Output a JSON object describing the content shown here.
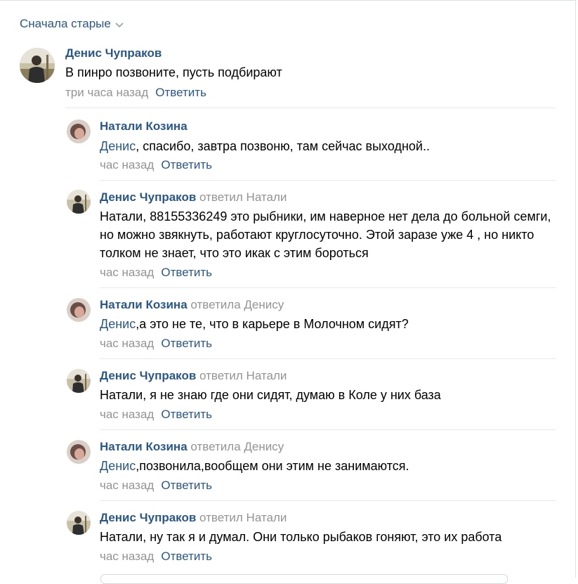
{
  "sort": {
    "label": "Сначала старые"
  },
  "main_comment": {
    "author": "Денис Чупраков",
    "text": "В пинро позвоните, пусть подбирают",
    "time": "три часа назад",
    "reply": "Ответить"
  },
  "replies": [
    {
      "author": "Натали Козина",
      "reply_to": "",
      "mention": "Денис",
      "text": ", спасибо, завтра позвоню, там сейчас выходной..",
      "time": "час назад",
      "reply": "Ответить"
    },
    {
      "author": "Денис Чупраков",
      "reply_to": "ответил Натали",
      "mention": "",
      "text": "Натали, 88155336249 это рыбники, им наверное нет дела до больной семги, но можно звякнуть, работают круглосуточно. Этой заразе уже 4 , но никто толком не знает, что это икак с этим бороться",
      "time": "час назад",
      "reply": "Ответить"
    },
    {
      "author": "Натали Козина",
      "reply_to": "ответила Денису",
      "mention": "Денис",
      "text": ",а это не те, что в карьере в Молочном сидят?",
      "time": "час назад",
      "reply": "Ответить"
    },
    {
      "author": "Денис Чупраков",
      "reply_to": "ответил Натали",
      "mention": "",
      "text": "Натали, я не знаю где они сидят, думаю в Коле у них база",
      "time": "час назад",
      "reply": "Ответить"
    },
    {
      "author": "Натали Козина",
      "reply_to": "ответила Денису",
      "mention": "Денис",
      "text": ",позвонила,вообщем они этим не занимаются.",
      "time": "час назад",
      "reply": "Ответить"
    },
    {
      "author": "Денис Чупраков",
      "reply_to": "ответил Натали",
      "mention": "",
      "text": "Натали, ну так я и думал. Они только рыбаков гоняют, это их работа",
      "time": "час назад",
      "reply": "Ответить"
    }
  ]
}
